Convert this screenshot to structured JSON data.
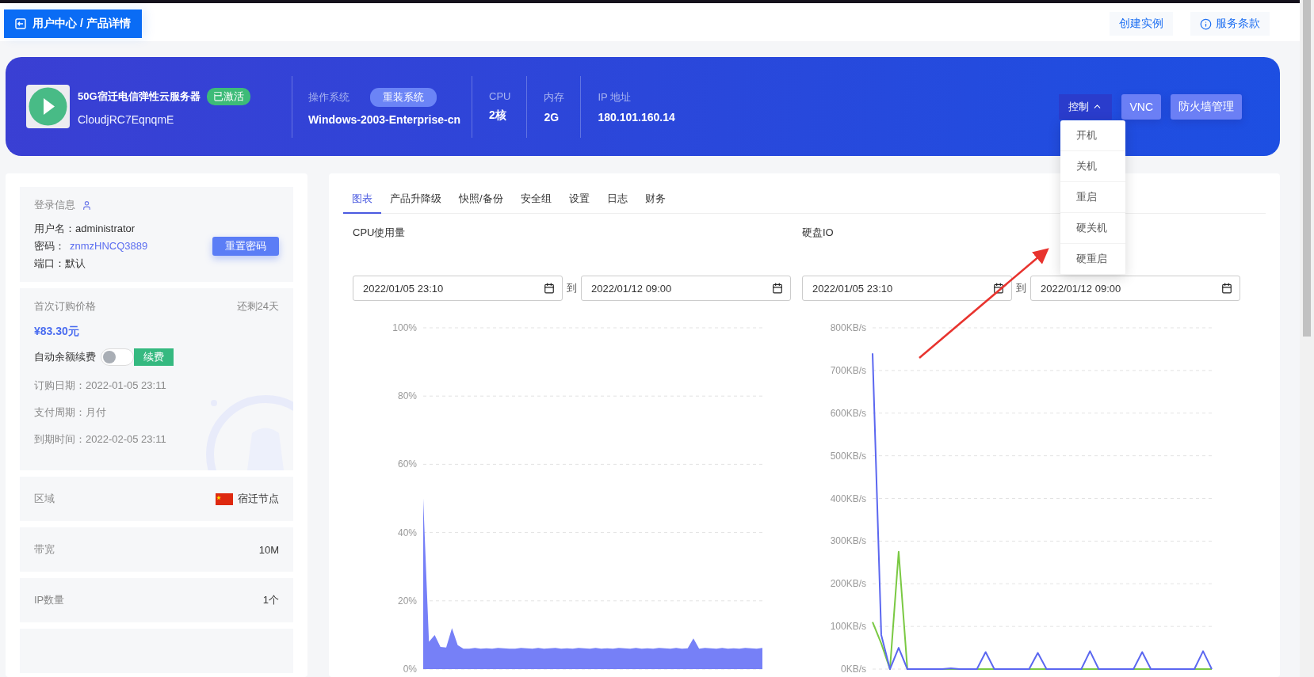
{
  "breadcrumb": {
    "label": "用户中心 / 产品详情"
  },
  "top_links": [
    {
      "label": "创建实例",
      "kind": "plain"
    },
    {
      "label": "服务条款",
      "kind": "info"
    }
  ],
  "product": {
    "name": "50G宿迁电信弹性云服务器",
    "status": "已激活",
    "id": "CloudjRC7EqnqmE",
    "specs": [
      {
        "label": "操作系统",
        "value": "Windows-2003-Enterprise-cn",
        "action": "重装系统"
      },
      {
        "label": "CPU",
        "value": "2核"
      },
      {
        "label": "内存",
        "value": "2G"
      },
      {
        "label": "IP 地址",
        "value": "180.101.160.14"
      }
    ],
    "buttons": [
      {
        "label": "控制",
        "kind": "dropdown",
        "expanded": true
      },
      {
        "label": "VNC",
        "kind": "plain"
      },
      {
        "label": "防火墙管理",
        "kind": "plain"
      }
    ]
  },
  "control_menu": [
    "开机",
    "关机",
    "重启",
    "硬关机",
    "硬重启"
  ],
  "login": {
    "title": "登录信息",
    "fields": [
      {
        "label": "用户名：",
        "value": "administrator",
        "kind": "text"
      },
      {
        "label": "密码：",
        "value": "znmzHNCQ3889",
        "kind": "link"
      },
      {
        "label": "端口：",
        "value": "默认",
        "kind": "text"
      }
    ],
    "button": "重置密码"
  },
  "billing": {
    "title": "首次订购价格",
    "remaining": "还剩24天",
    "price": "¥83.30元",
    "auto_renew": {
      "label": "自动余额续费",
      "on": false
    },
    "renew_button": "续费",
    "details": [
      {
        "label": "订购日期：",
        "value": "2022-01-05 23:11"
      },
      {
        "label": "支付周期：",
        "value": "月付"
      },
      {
        "label": "到期时间：",
        "value": "2022-02-05 23:11"
      }
    ]
  },
  "info_rows": [
    {
      "label": "区域",
      "value": "宿迁节点",
      "kind": "flag"
    },
    {
      "label": "带宽",
      "value": "10M",
      "kind": "plain"
    },
    {
      "label": "IP数量",
      "value": "1个",
      "kind": "plain"
    }
  ],
  "tabs": [
    {
      "label": "图表",
      "selected": true
    },
    {
      "label": "产品升降级",
      "selected": false
    },
    {
      "label": "快照/备份",
      "selected": false
    },
    {
      "label": "安全组",
      "selected": false
    },
    {
      "label": "设置",
      "selected": false
    },
    {
      "label": "日志",
      "selected": false
    },
    {
      "label": "财务",
      "selected": false
    }
  ],
  "charts": [
    {
      "title": "CPU使用量",
      "from": "2022/01/05 23:10",
      "separator": "到",
      "to": [
        "2022/01/12 09:00"
      ],
      "chart_data": {
        "type": "area",
        "grid": true,
        "ylim": [
          0,
          100
        ],
        "yticks": [
          {
            "value": 0,
            "label": "0%"
          },
          {
            "value": 20,
            "label": "20%"
          },
          {
            "value": 40,
            "label": "40%"
          },
          {
            "value": 60,
            "label": "60%"
          },
          {
            "value": 80,
            "label": "80%"
          },
          {
            "value": 100,
            "label": "100%"
          }
        ],
        "series": [
          {
            "color": "#7680f7",
            "values": [
              50,
              8,
              10,
              6.5,
              6.3,
              12,
              7,
              6,
              6,
              6.2,
              6,
              6.1,
              6,
              6.2,
              6.1,
              6,
              6,
              6.2,
              6.1,
              6,
              6.2,
              6,
              6.1,
              6.2,
              6,
              6.1,
              6,
              6.2,
              6.1,
              6,
              6.2,
              6,
              6.1,
              6,
              6.2,
              6.1,
              6,
              6.2,
              6,
              6.1,
              6,
              6.2,
              6.1,
              6,
              6.2,
              6,
              6.1,
              9,
              6,
              6.2,
              6.1,
              6,
              6.2,
              6,
              6.1,
              6,
              6.2,
              6.1,
              6,
              6.2
            ]
          }
        ]
      }
    },
    {
      "title": "硬盘IO",
      "from": "2022/01/05 23:10",
      "separator": "到",
      "to": [
        "2022/01/12 09:00"
      ],
      "chart_data": {
        "type": "line",
        "grid": true,
        "ylim": [
          0,
          800
        ],
        "yticks": [
          {
            "value": 0,
            "label": "0KB/s"
          },
          {
            "value": 100,
            "label": "100KB/s"
          },
          {
            "value": 200,
            "label": "200KB/s"
          },
          {
            "value": 300,
            "label": "300KB/s"
          },
          {
            "value": 400,
            "label": "400KB/s"
          },
          {
            "value": 500,
            "label": "500KB/s"
          },
          {
            "value": 600,
            "label": "600KB/s"
          },
          {
            "value": 700,
            "label": "700KB/s"
          },
          {
            "value": 800,
            "label": "800KB/s"
          }
        ],
        "series": [
          {
            "color": "#7ac943",
            "values": [
              110,
              60,
              0,
              275,
              0,
              0,
              0,
              0,
              0,
              0,
              0,
              0,
              0,
              0,
              0,
              0,
              0,
              0,
              0,
              0,
              0,
              0,
              0,
              0,
              0,
              0,
              0,
              0,
              0,
              0,
              0,
              0,
              0,
              0,
              0,
              0,
              0,
              0,
              0,
              0
            ]
          },
          {
            "color": "#5b67f0",
            "values": [
              740,
              80,
              0,
              50,
              0,
              0,
              0,
              0,
              0,
              2,
              0,
              0,
              0,
              40,
              0,
              0,
              0,
              0,
              0,
              38,
              0,
              0,
              0,
              0,
              0,
              42,
              0,
              0,
              0,
              0,
              0,
              40,
              0,
              0,
              0,
              0,
              0,
              0,
              42,
              0
            ]
          }
        ]
      }
    }
  ]
}
